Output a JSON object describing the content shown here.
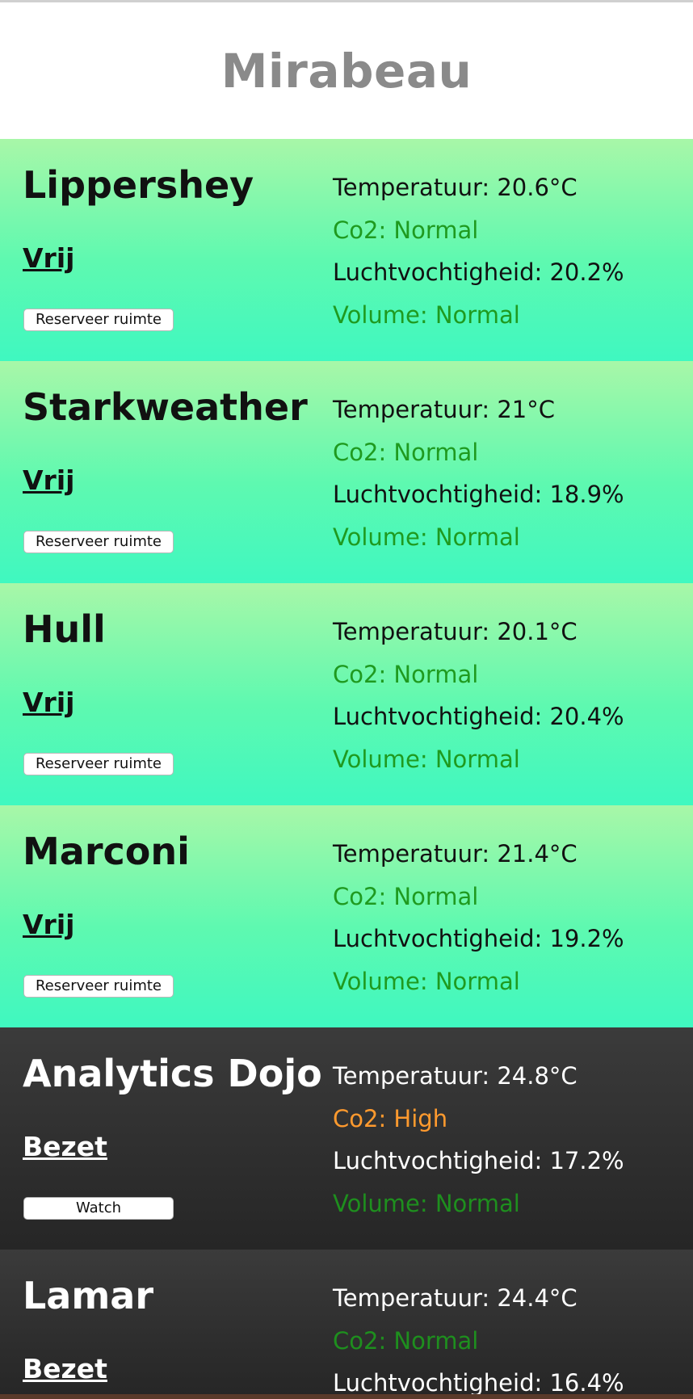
{
  "header": {
    "title": "Mirabeau"
  },
  "labels": {
    "temperature": "Temperatuur: ",
    "co2": "Co2: ",
    "humidity": "Luchtvochtigheid: ",
    "volume": "Volume: "
  },
  "colors": {
    "free_gradient_top": "#a8f7a8",
    "free_gradient_bottom": "#3ff8c0",
    "busy_background": "#2e2e2e",
    "normal_text": "#1f9a1f",
    "high_text": "#ff9a2e",
    "title_gray": "#8a8a8a"
  },
  "rooms": [
    {
      "name": "Lippershey",
      "status": "Vrij",
      "button": "Reserveer ruimte",
      "temperature": "Temperatuur: 20.6°C",
      "co2": "Co2: Normal",
      "humidity": "Luchtvochtigheid: 20.2%",
      "volume": "Volume: Normal"
    },
    {
      "name": "Starkweather",
      "status": "Vrij",
      "button": "Reserveer ruimte",
      "temperature": "Temperatuur: 21°C",
      "co2": "Co2: Normal",
      "humidity": "Luchtvochtigheid: 18.9%",
      "volume": "Volume: Normal"
    },
    {
      "name": "Hull",
      "status": "Vrij",
      "button": "Reserveer ruimte",
      "temperature": "Temperatuur: 20.1°C",
      "co2": "Co2: Normal",
      "humidity": "Luchtvochtigheid: 20.4%",
      "volume": "Volume: Normal"
    },
    {
      "name": "Marconi",
      "status": "Vrij",
      "button": "Reserveer ruimte",
      "temperature": "Temperatuur: 21.4°C",
      "co2": "Co2: Normal",
      "humidity": "Luchtvochtigheid: 19.2%",
      "volume": "Volume: Normal"
    },
    {
      "name": "Analytics Dojo",
      "status": "Bezet",
      "button": "Watch",
      "temperature": "Temperatuur: 24.8°C",
      "co2": "Co2: High",
      "humidity": "Luchtvochtigheid: 17.2%",
      "volume": "Volume: Normal"
    },
    {
      "name": "Lamar",
      "status": "Bezet",
      "temperature": "Temperatuur: 24.4°C",
      "co2": "Co2: Normal",
      "humidity": "Luchtvochtigheid: 16.4%"
    }
  ]
}
